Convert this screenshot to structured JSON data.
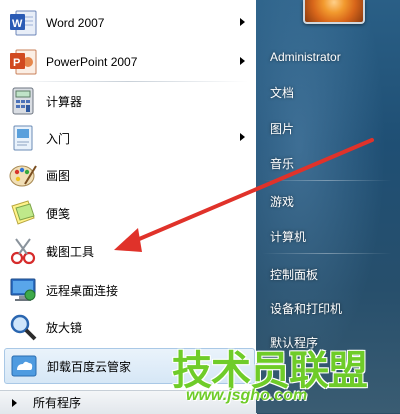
{
  "start_menu": {
    "programs": [
      {
        "label": "Word 2007",
        "icon": "word-icon",
        "has_submenu": true
      },
      {
        "label": "PowerPoint 2007",
        "icon": "powerpoint-icon",
        "has_submenu": true
      },
      {
        "label": "计算器",
        "icon": "calculator-icon",
        "has_submenu": false
      },
      {
        "label": "入门",
        "icon": "getting-started-icon",
        "has_submenu": true
      },
      {
        "label": "画图",
        "icon": "paint-icon",
        "has_submenu": false
      },
      {
        "label": "便笺",
        "icon": "sticky-notes-icon",
        "has_submenu": false
      },
      {
        "label": "截图工具",
        "icon": "snipping-tool-icon",
        "has_submenu": false
      },
      {
        "label": "远程桌面连接",
        "icon": "remote-desktop-icon",
        "has_submenu": false
      },
      {
        "label": "放大镜",
        "icon": "magnifier-icon",
        "has_submenu": false
      },
      {
        "label": "卸载百度云管家",
        "icon": "baidu-cloud-icon",
        "has_submenu": false,
        "highlighted": true
      }
    ],
    "all_programs": "所有程序",
    "right_items": [
      {
        "label": "Administrator"
      },
      {
        "label": "文档"
      },
      {
        "label": "图片"
      },
      {
        "label": "音乐"
      },
      {
        "label": "游戏"
      },
      {
        "label": "计算机"
      },
      {
        "label": "控制面板"
      },
      {
        "label": "设备和打印机"
      },
      {
        "label": "默认程序"
      }
    ]
  },
  "watermark": {
    "brand": "技术员联盟",
    "url": "www.jsgho.com"
  },
  "colors": {
    "annotation_arrow": "#e0322a",
    "watermark_green": "#6fcc29"
  }
}
